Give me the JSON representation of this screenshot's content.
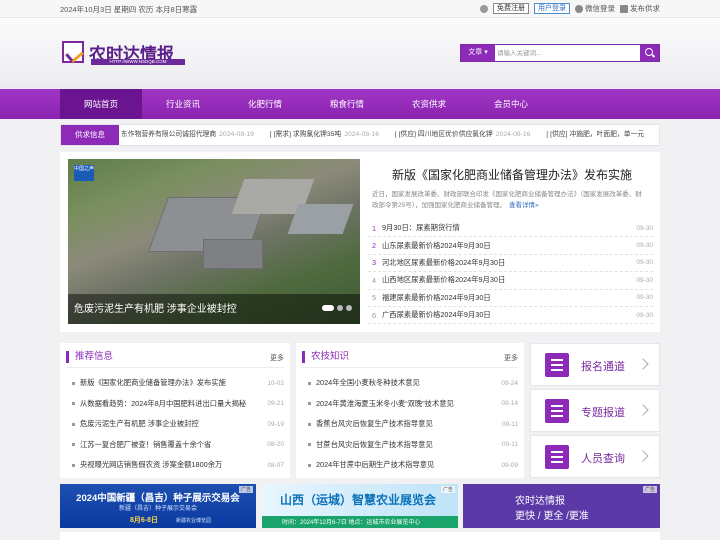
{
  "topbar": {
    "date": "2024年10月3日 星期四 农历 本月8日寒露",
    "register": "免费注册",
    "login": "用户登录",
    "wechat_login": "微信登录",
    "publish": "发布供求"
  },
  "logo": {
    "name": "农时达情报",
    "url": "HTTP://WWW.NSDQB.COM"
  },
  "search": {
    "select": "文章",
    "placeholder": "请输入关键词..."
  },
  "nav": {
    "items": [
      "网站首页",
      "行业资讯",
      "化肥行情",
      "粮食行情",
      "农资供求",
      "会员中心"
    ]
  },
  "ticker": {
    "label": "供求信息",
    "items": [
      {
        "text": "东作物营养有限公司诚招代理商",
        "date": "2024-08-19"
      },
      {
        "text": "[需求] 求购氯化钾35吨",
        "date": "2024-08-16"
      },
      {
        "text": "[供应] 四川地区优价供应氯化钾",
        "date": "2024-08-16"
      },
      {
        "text": "[供应] 冲施肥，叶面肥，单一元",
        "date": ""
      }
    ]
  },
  "hero": {
    "badge": "中国之声",
    "caption": "危废污泥生产有机肥 涉事企业被封控",
    "headline": "新版《国家化肥商业储备管理办法》发布实施",
    "summary": "近日，国家发展改革委、财政部联合印发《国家化肥商业储备管理办法》（国家发展改革委、财政部令第25号），加强国家化肥商业储备管理。",
    "summary_more": "查看详情»",
    "list": [
      {
        "n": "1",
        "text": "9月30日：尿素期货行情",
        "date": "09-30"
      },
      {
        "n": "2",
        "text": "山东尿素最新价格2024年9月30日",
        "date": "09-30"
      },
      {
        "n": "3",
        "text": "河北地区尿素最新价格2024年9月30日",
        "date": "09-30"
      },
      {
        "n": "4",
        "text": "山西地区尿素最新价格2024年9月30日",
        "date": "09-30"
      },
      {
        "n": "5",
        "text": "福建尿素最新价格2024年9月30日",
        "date": "09-30"
      },
      {
        "n": "6",
        "text": "广西尿素最新价格2024年9月30日",
        "date": "09-30"
      }
    ]
  },
  "recommend": {
    "title": "推荐信息",
    "more": "更多",
    "items": [
      {
        "text": "新版《国家化肥商业储备管理办法》发布实施",
        "date": "10-02"
      },
      {
        "text": "从数据看趋势：2024年8月中国肥料进出口量大揭秘",
        "date": "09-21"
      },
      {
        "text": "危废污泥生产有机肥 涉事企业被封控",
        "date": "09-19"
      },
      {
        "text": "江苏一复合肥厂被查！销售覆盖十余个省",
        "date": "08-20"
      },
      {
        "text": "央视曝光网店销售假农资 涉案金额1800余万",
        "date": "08-07"
      }
    ]
  },
  "knowledge": {
    "title": "农技知识",
    "more": "更多",
    "items": [
      {
        "text": "2024年全国小麦秋冬种技术意见",
        "date": "09-24"
      },
      {
        "text": "2024年黄淮海夏玉米冬小麦“双晚”技术意见",
        "date": "09-14"
      },
      {
        "text": "香蕉台风灾后恢复生产技术指导意见",
        "date": "09-11"
      },
      {
        "text": "甘蔗台风灾后恢复生产技术指导意见",
        "date": "09-11"
      },
      {
        "text": "2024年甘蔗中后期生产技术指导意见",
        "date": "09-09"
      }
    ]
  },
  "side": {
    "items": [
      "报名通道",
      "专题报道",
      "人员查询"
    ]
  },
  "ads": {
    "tag": "广告",
    "ad1_title": "2024中国新疆（昌吉）种子展示交易会",
    "ad1_sub": "新疆（昌吉）种子展示交易会",
    "ad1_date": "8月6-8日",
    "ad1_place": "新疆农业博览园",
    "ad2_title": "山西（运城）智慧农业展览会",
    "ad2_sub": "时间：2024年12月6-7日   地点：运城市农业展览中心",
    "ad3_line1": "农时达情报",
    "ad3_line2": "更快 / 更全 /更准"
  }
}
